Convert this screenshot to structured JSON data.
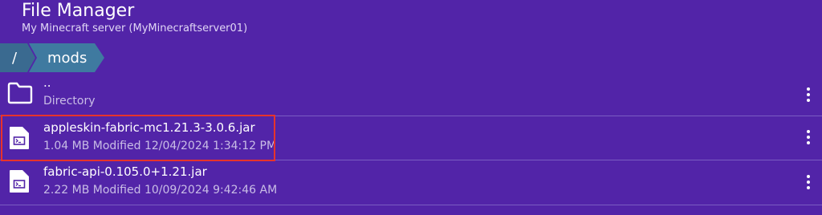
{
  "header": {
    "title": "File Manager",
    "subtitle": "My Minecraft server (MyMinecraftserver01)"
  },
  "breadcrumb": {
    "root": "/",
    "current": "mods"
  },
  "files": [
    {
      "name": "..",
      "meta": "Directory",
      "icon": "folder-icon"
    },
    {
      "name": "appleskin-fabric-mc1.21.3-3.0.6.jar",
      "meta": "1.04 MB Modified 12/04/2024 1:34:12 PM",
      "icon": "file-terminal-icon"
    },
    {
      "name": "fabric-api-0.105.0+1.21.jar",
      "meta": "2.22 MB Modified 10/09/2024 9:42:46 AM",
      "icon": "file-terminal-icon"
    }
  ],
  "colors": {
    "background": "#5224a8",
    "breadcrumb": "#3f7aa0",
    "highlight": "#e8332b"
  }
}
